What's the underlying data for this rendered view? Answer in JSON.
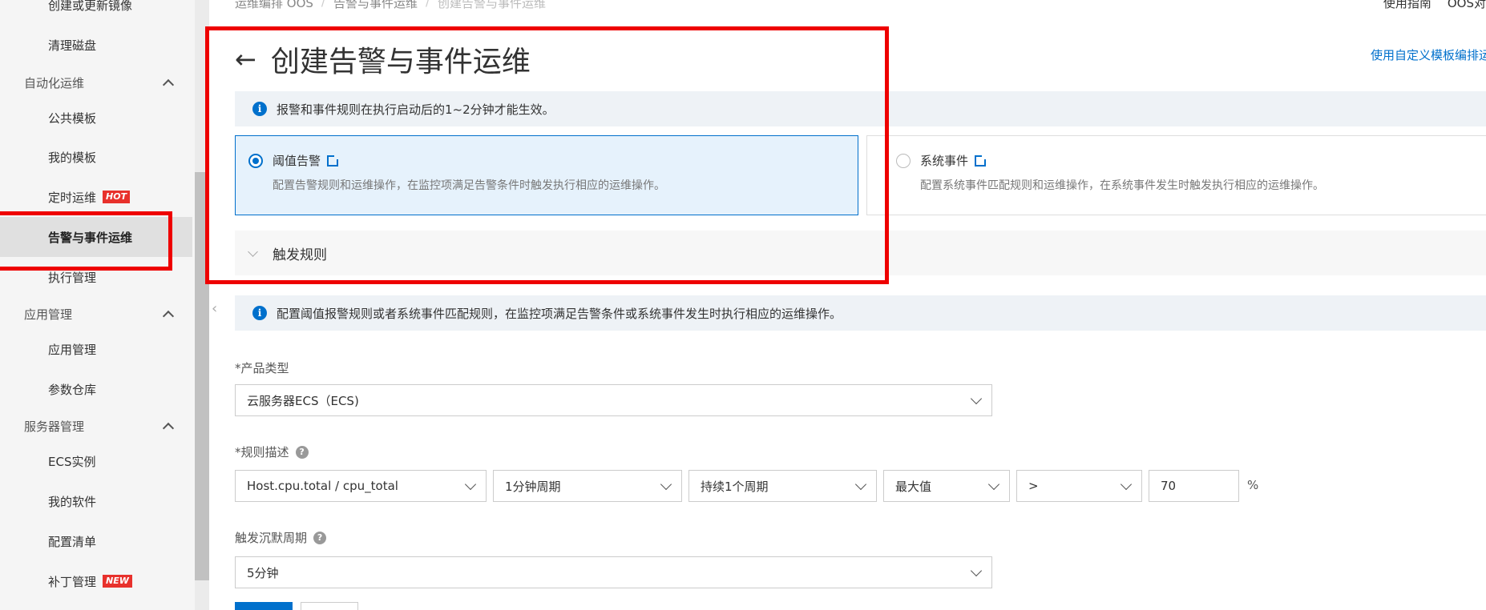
{
  "sidebar": {
    "items": [
      {
        "label": "创建或更新镜像"
      },
      {
        "label": "清理磁盘"
      },
      {
        "label": "自动化运维"
      },
      {
        "label": "公共模板"
      },
      {
        "label": "我的模板"
      },
      {
        "label": "定时运维",
        "badge": "HOT"
      },
      {
        "label": "告警与事件运维"
      },
      {
        "label": "执行管理"
      },
      {
        "label": "应用管理"
      },
      {
        "label": "应用管理"
      },
      {
        "label": "参数仓库"
      },
      {
        "label": "服务器管理"
      },
      {
        "label": "ECS实例"
      },
      {
        "label": "我的软件"
      },
      {
        "label": "配置清单"
      },
      {
        "label": "补丁管理",
        "badge": "NEW"
      }
    ]
  },
  "breadcrumb": [
    "运维编排 OOS",
    "告警与事件运维",
    "创建告警与事件运维"
  ],
  "header": {
    "guide": "使用指南",
    "product": "OOS对"
  },
  "page": {
    "back_icon": "back-arrow-icon",
    "title": "创建告警与事件运维",
    "custom_template_link": "使用自定义模板编排运维"
  },
  "info": {
    "top_notice": "报警和事件规则在执行启动后的1~2分钟才能生效。",
    "rule_notice": "配置阈值报警规则或者系统事件匹配规则，在监控项满足告警条件或系统事件发生时执行相应的运维操作。"
  },
  "cards": [
    {
      "title": "阈值告警",
      "desc": "配置告警规则和运维操作，在监控项满足告警条件时触发执行相应的运维操作。",
      "selected": true
    },
    {
      "title": "系统事件",
      "desc": "配置系统事件匹配规则和运维操作，在系统事件发生时触发执行相应的运维操作。",
      "selected": false
    }
  ],
  "trigger": {
    "label": "触发规则"
  },
  "form": {
    "product_type": {
      "label": "*产品类型",
      "value": "云服务器ECS（ECS)"
    },
    "rule_desc": {
      "label": "*规则描述",
      "metric": "Host.cpu.total / cpu_total",
      "period": "1分钟周期",
      "duration": "持续1个周期",
      "stat": "最大值",
      "operator": ">",
      "threshold": "70",
      "unit": "%"
    },
    "silence": {
      "label": "触发沉默周期",
      "value": "5分钟"
    }
  },
  "colors": {
    "accent": "#0070cc",
    "highlight": "#ee0000",
    "badge": "#e8312c"
  }
}
